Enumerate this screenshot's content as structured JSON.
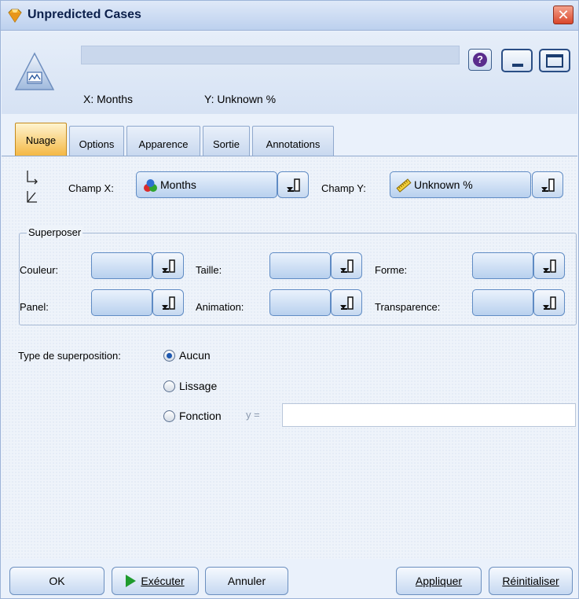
{
  "window": {
    "title": "Unpredicted Cases",
    "close_label": "✕",
    "help_label": "?"
  },
  "header": {
    "node_name_value": "",
    "x_label": "X: Months",
    "y_label": "Y: Unknown %"
  },
  "tabs": [
    {
      "label": "Nuage",
      "active": true
    },
    {
      "label": "Options",
      "active": false
    },
    {
      "label": "Apparence",
      "active": false
    },
    {
      "label": "Sortie",
      "active": false
    },
    {
      "label": "Annotations",
      "active": false
    }
  ],
  "fields": {
    "x_label": "Champ X:",
    "x_value": "Months",
    "x_icon": "nominal-field-icon",
    "y_label": "Champ Y:",
    "y_value": "Unknown %",
    "y_icon": "continuous-field-icon"
  },
  "overlay": {
    "title": "Superposer",
    "couleur_label": "Couleur:",
    "couleur_value": "",
    "taille_label": "Taille:",
    "taille_value": "",
    "forme_label": "Forme:",
    "forme_value": "",
    "panel_label": "Panel:",
    "panel_value": "",
    "animation_label": "Animation:",
    "animation_value": "",
    "transparence_label": "Transparence:",
    "transparence_value": ""
  },
  "overlay_type": {
    "label": "Type de superposition:",
    "options": [
      {
        "label": "Aucun",
        "selected": true
      },
      {
        "label": "Lissage",
        "selected": false
      },
      {
        "label": "Fonction",
        "selected": false
      }
    ],
    "function_prefix": "y =",
    "function_value": ""
  },
  "buttons": {
    "ok": "OK",
    "run": "Exécuter",
    "cancel": "Annuler",
    "apply": "Appliquer",
    "reset": "Réinitialiser"
  },
  "colors": {
    "active_tab": "#f4b844",
    "accent": "#1d58b0"
  }
}
